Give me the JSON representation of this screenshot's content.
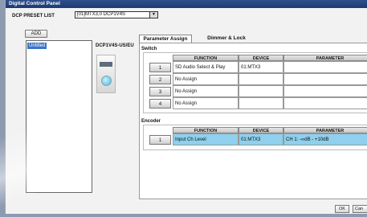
{
  "window": {
    "title": "Digital Control Panel"
  },
  "preset": {
    "label": "DCP PRESET LIST",
    "selected": "[01]MTX3,0 DCP1V4S",
    "dropdown_icon": "chevron-down-icon"
  },
  "sidebar": {
    "add_label": "ADD",
    "items": [
      {
        "label": "Untitled",
        "selected": true
      }
    ]
  },
  "device": {
    "label": "DCP1V4S-US/EU"
  },
  "tabs": [
    {
      "label": "Parameter Assign",
      "active": true
    },
    {
      "label": "Dimmer & Lock",
      "active": false
    }
  ],
  "switch": {
    "title": "Switch",
    "columns": [
      "FUNCTION",
      "DEVICE",
      "PARAMETER"
    ],
    "rows": [
      {
        "num": "1",
        "function": "SD Audio Select & Play",
        "device": "01:MTX3",
        "parameter": ""
      },
      {
        "num": "2",
        "function": "No Assign",
        "device": "",
        "parameter": ""
      },
      {
        "num": "3",
        "function": "No Assign",
        "device": "",
        "parameter": ""
      },
      {
        "num": "4",
        "function": "No Assign",
        "device": "",
        "parameter": ""
      }
    ]
  },
  "encoder": {
    "title": "Encoder",
    "columns": [
      "FUNCTION",
      "DEVICE",
      "PARAMETER"
    ],
    "rows": [
      {
        "num": "1",
        "function": "Input Ch Level",
        "device": "01:MTX3",
        "parameter": "CH 1: -∞dB - +10dB",
        "selected": true
      }
    ]
  },
  "footer": {
    "ok_label": "OK",
    "cancel_label": "Can"
  },
  "colors": {
    "titlebar": "#1e3a70",
    "selection": "#3b74c9",
    "highlight_row": "#8ed0ee"
  }
}
